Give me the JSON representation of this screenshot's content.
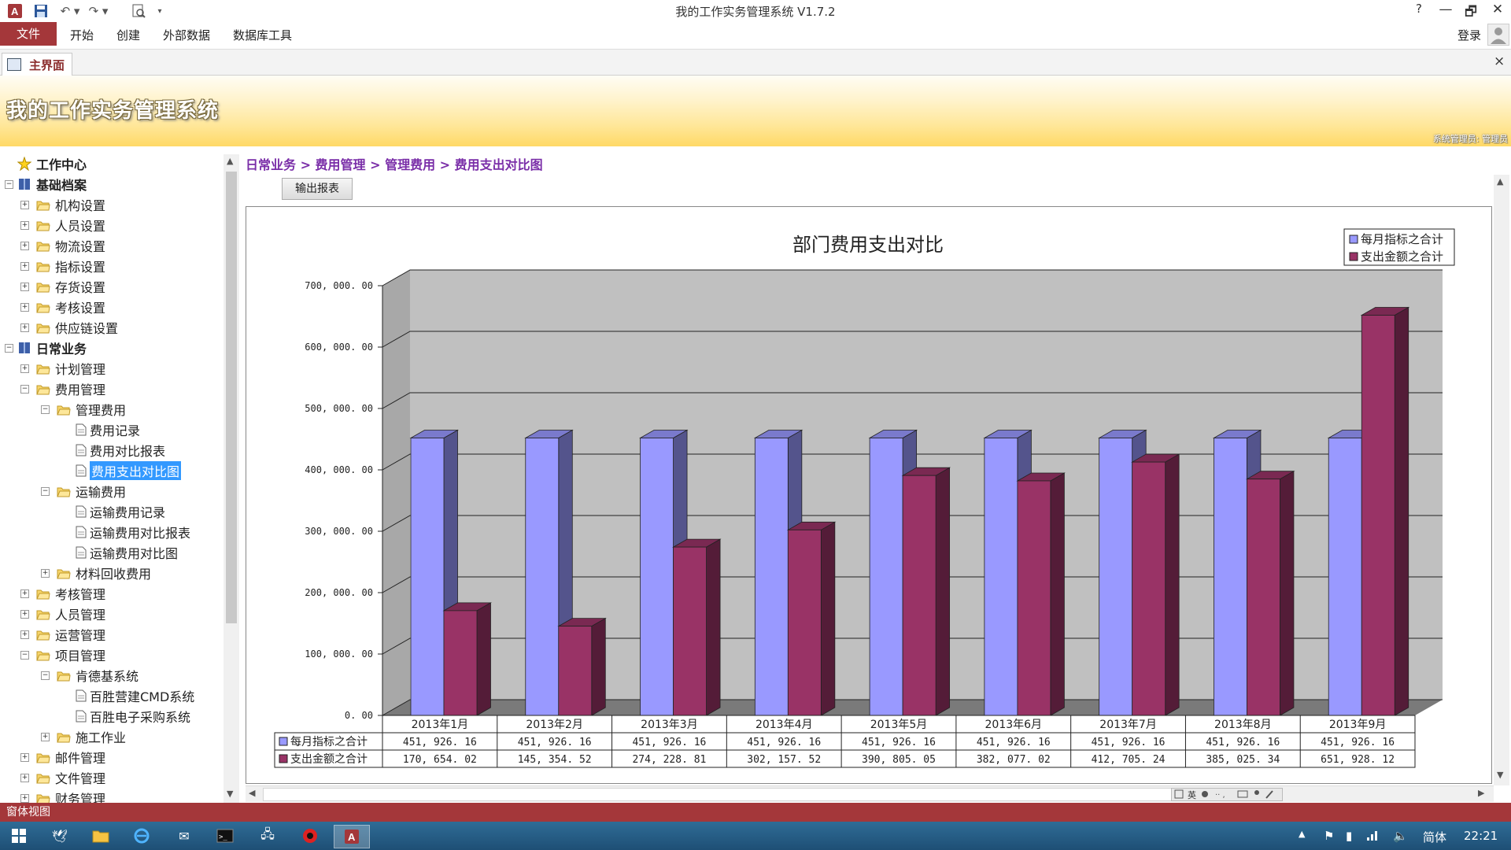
{
  "window": {
    "title": "我的工作实务管理系统 V1.7.2",
    "help": "?",
    "minimize": "—",
    "restore": "🗗",
    "close": "✕"
  },
  "ribbon": {
    "tabs": [
      "文件",
      "开始",
      "创建",
      "外部数据",
      "数据库工具"
    ],
    "login": "登录"
  },
  "doc_tab": {
    "label": "主界面",
    "close": "×"
  },
  "banner": {
    "title": "我的工作实务管理系统",
    "user": "系统管理员: 管理员"
  },
  "tree": [
    {
      "label": "工作中心",
      "level": 0,
      "icon": "star-icon",
      "bold": true
    },
    {
      "label": "基础档案",
      "level": 0,
      "icon": "book-icon",
      "bold": true,
      "expander": "−"
    },
    {
      "label": "机构设置",
      "level": 1,
      "icon": "folder-icon",
      "expander": "+"
    },
    {
      "label": "人员设置",
      "level": 1,
      "icon": "folder-icon",
      "expander": "+"
    },
    {
      "label": "物流设置",
      "level": 1,
      "icon": "folder-icon",
      "expander": "+"
    },
    {
      "label": "指标设置",
      "level": 1,
      "icon": "folder-icon",
      "expander": "+"
    },
    {
      "label": "存货设置",
      "level": 1,
      "icon": "folder-icon",
      "expander": "+"
    },
    {
      "label": "考核设置",
      "level": 1,
      "icon": "folder-icon",
      "expander": "+"
    },
    {
      "label": "供应链设置",
      "level": 1,
      "icon": "folder-icon",
      "expander": "+"
    },
    {
      "label": "日常业务",
      "level": 0,
      "icon": "book-icon",
      "bold": true,
      "expander": "−"
    },
    {
      "label": "计划管理",
      "level": 1,
      "icon": "folder-icon",
      "expander": "+"
    },
    {
      "label": "费用管理",
      "level": 1,
      "icon": "folder-icon",
      "expander": "−"
    },
    {
      "label": "管理费用",
      "level": 2,
      "icon": "folder-icon",
      "expander": "−"
    },
    {
      "label": "费用记录",
      "level": 3,
      "icon": "document-icon"
    },
    {
      "label": "费用对比报表",
      "level": 3,
      "icon": "document-icon"
    },
    {
      "label": "费用支出对比图",
      "level": 3,
      "icon": "document-icon",
      "selected": true
    },
    {
      "label": "运输费用",
      "level": 2,
      "icon": "folder-icon",
      "expander": "−"
    },
    {
      "label": "运输费用记录",
      "level": 3,
      "icon": "document-icon"
    },
    {
      "label": "运输费用对比报表",
      "level": 3,
      "icon": "document-icon"
    },
    {
      "label": "运输费用对比图",
      "level": 3,
      "icon": "document-icon"
    },
    {
      "label": "材料回收费用",
      "level": 2,
      "icon": "folder-icon",
      "expander": "+"
    },
    {
      "label": "考核管理",
      "level": 1,
      "icon": "folder-icon",
      "expander": "+"
    },
    {
      "label": "人员管理",
      "level": 1,
      "icon": "folder-icon",
      "expander": "+"
    },
    {
      "label": "运营管理",
      "level": 1,
      "icon": "folder-icon",
      "expander": "+"
    },
    {
      "label": "项目管理",
      "level": 1,
      "icon": "folder-icon",
      "expander": "−"
    },
    {
      "label": "肯德基系统",
      "level": 2,
      "icon": "folder-icon",
      "expander": "−"
    },
    {
      "label": "百胜营建CMD系统",
      "level": 3,
      "icon": "document-icon"
    },
    {
      "label": "百胜电子采购系统",
      "level": 3,
      "icon": "document-icon"
    },
    {
      "label": "施工作业",
      "level": 2,
      "icon": "folder-icon",
      "expander": "+"
    },
    {
      "label": "邮件管理",
      "level": 1,
      "icon": "folder-icon",
      "expander": "+"
    },
    {
      "label": "文件管理",
      "level": 1,
      "icon": "folder-icon",
      "expander": "+"
    },
    {
      "label": "财务管理",
      "level": 1,
      "icon": "folder-icon",
      "expander": "+"
    }
  ],
  "breadcrumb": "日常业务 > 费用管理 > 管理费用 > 费用支出对比图",
  "export_button": "输出报表",
  "chart_data": {
    "type": "bar",
    "title": "部门费用支出对比",
    "categories": [
      "2013年1月",
      "2013年2月",
      "2013年3月",
      "2013年4月",
      "2013年5月",
      "2013年6月",
      "2013年7月",
      "2013年8月",
      "2013年9月"
    ],
    "series": [
      {
        "name": "每月指标之合计",
        "color": "#9999ff",
        "values": [
          451926.16,
          451926.16,
          451926.16,
          451926.16,
          451926.16,
          451926.16,
          451926.16,
          451926.16,
          451926.16
        ],
        "labels": [
          "451, 926. 16",
          "451, 926. 16",
          "451, 926. 16",
          "451, 926. 16",
          "451, 926. 16",
          "451, 926. 16",
          "451, 926. 16",
          "451, 926. 16",
          "451, 926. 16"
        ]
      },
      {
        "name": "支出金额之合计",
        "color": "#993366",
        "values": [
          170654.02,
          145354.52,
          274228.81,
          302157.52,
          390805.05,
          382077.02,
          412705.24,
          385025.34,
          651928.12
        ],
        "labels": [
          "170, 654. 02",
          "145, 354. 52",
          "274, 228. 81",
          "302, 157. 52",
          "390, 805. 05",
          "382, 077. 02",
          "412, 705. 24",
          "385, 025. 34",
          "651, 928. 12"
        ]
      }
    ],
    "ylim": [
      0,
      700000
    ],
    "yticks": [
      "0. 00",
      "100, 000. 00",
      "200, 000. 00",
      "300, 000. 00",
      "400, 000. 00",
      "500, 000. 00",
      "600, 000. 00",
      "700, 000. 00"
    ],
    "legend": "top-right",
    "grid": true
  },
  "status_bar": "窗体视图",
  "taskbar": {
    "ime_lang": "简体",
    "clock": "22:21"
  },
  "colors": {
    "accent": "#a4373a",
    "breadcrumb": "#7a2ea8"
  }
}
